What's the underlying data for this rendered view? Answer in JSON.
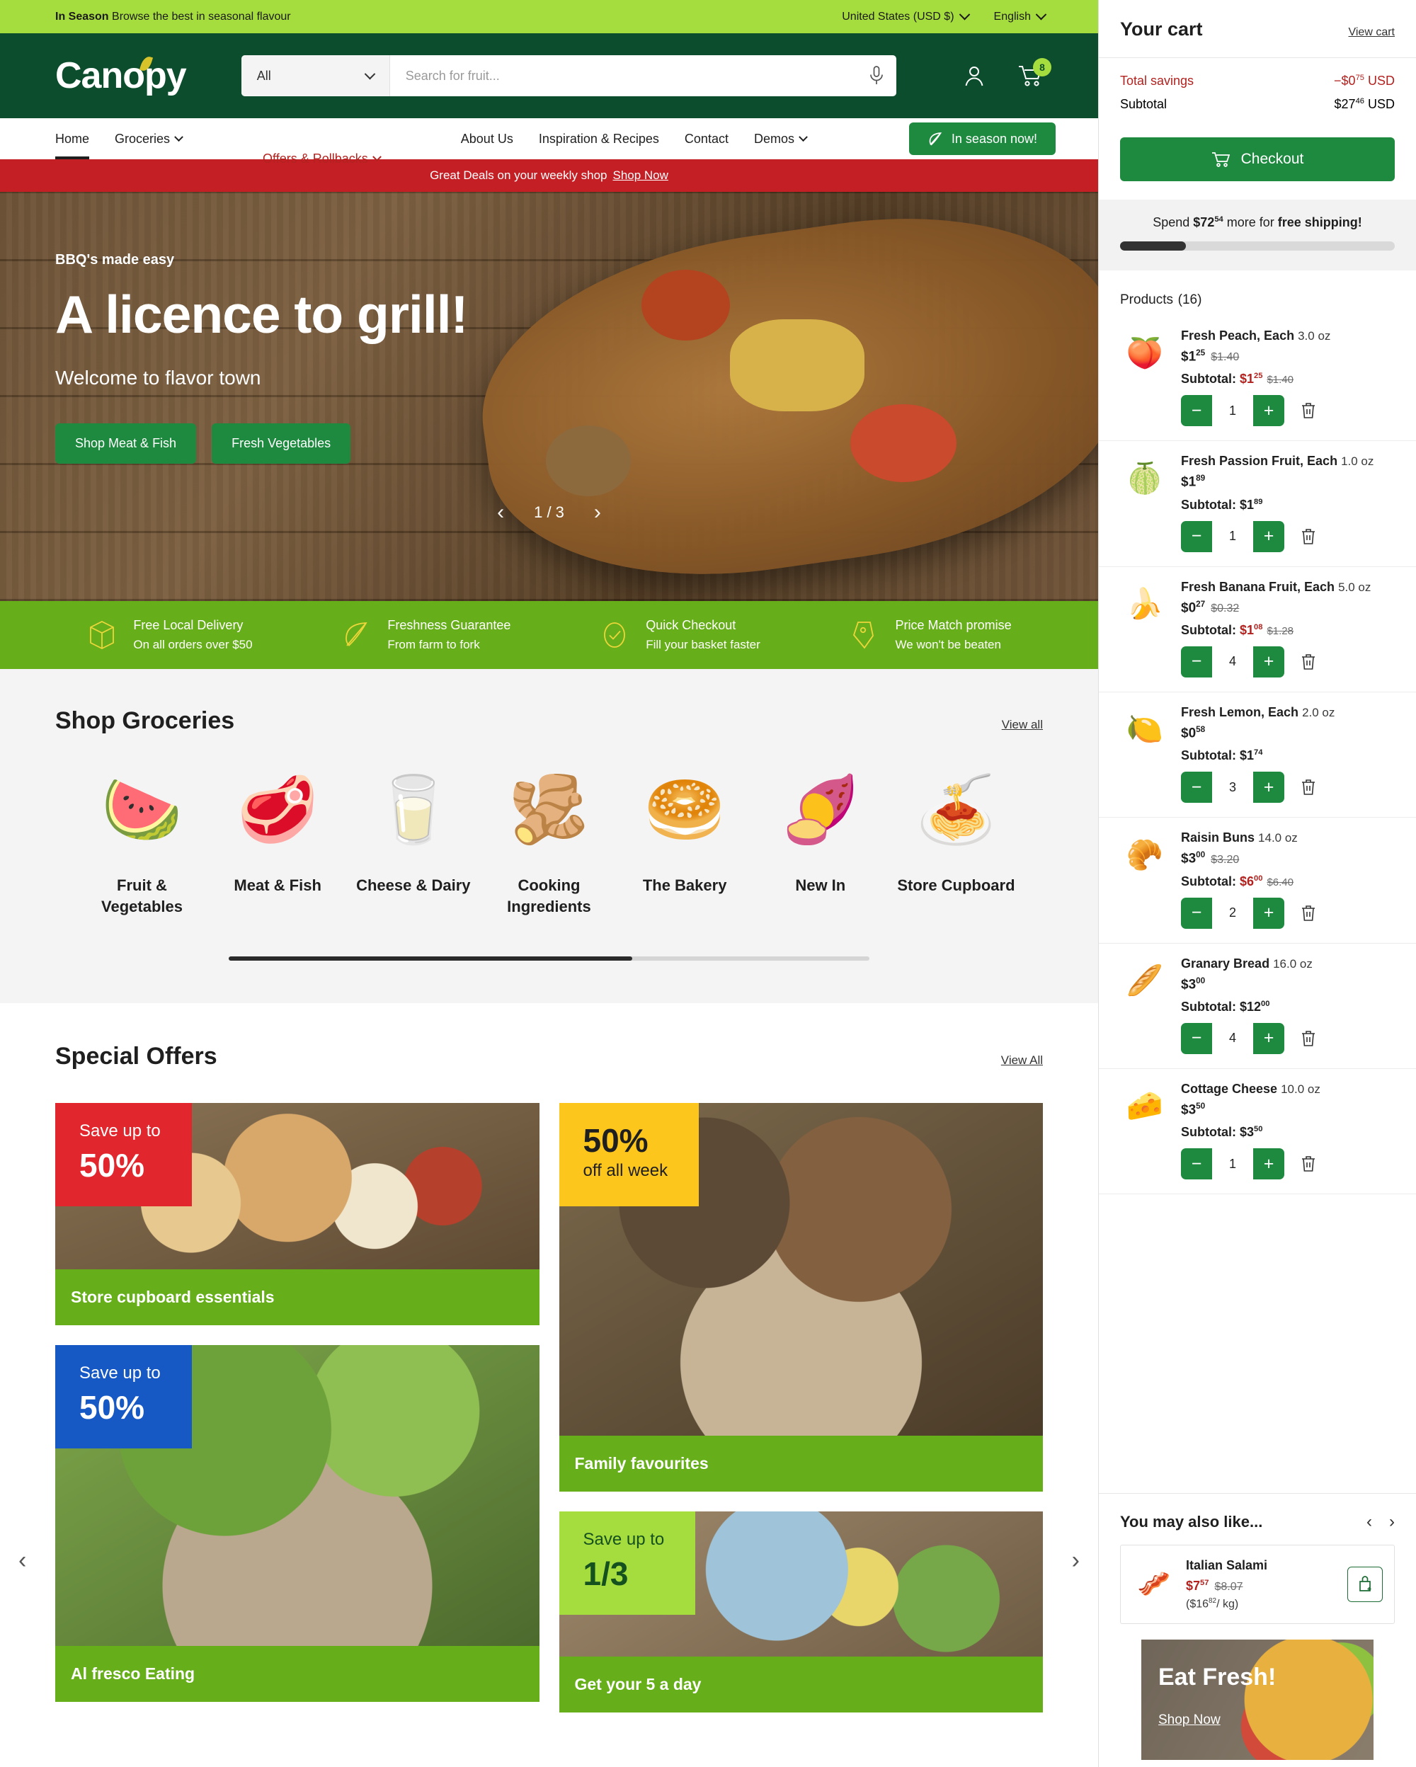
{
  "topbar": {
    "in_season_label": "In Season",
    "in_season_text": " Browse the best in seasonal flavour",
    "country": "United States (USD $)",
    "language": "English"
  },
  "header": {
    "logo": "Canopy",
    "search_category": "All",
    "search_placeholder": "Search for fruit...",
    "cart_badge": "8"
  },
  "nav": {
    "items": [
      {
        "label": "Home"
      },
      {
        "label": "Groceries"
      },
      {
        "label": "Offers & Rollbacks"
      },
      {
        "label": "About Us"
      },
      {
        "label": "Inspiration & Recipes"
      },
      {
        "label": "Contact"
      },
      {
        "label": "Demos"
      }
    ],
    "season_button": "In season now!"
  },
  "promo": {
    "text": "Great Deals on your weekly shop",
    "link": "Shop Now"
  },
  "hero": {
    "eyebrow": "BBQ's made easy",
    "title": "A licence to grill!",
    "subtitle": "Welcome to flavor town",
    "button_1": "Shop Meat & Fish",
    "button_2": "Fresh Vegetables",
    "counter": "1 / 3"
  },
  "features": [
    {
      "icon": "box-icon",
      "title": "Free Local Delivery",
      "sub": "On all orders over $50"
    },
    {
      "icon": "leaf-icon",
      "title": "Freshness Guarantee",
      "sub": "From farm to fork"
    },
    {
      "icon": "check-circle-icon",
      "title": "Quick Checkout",
      "sub": "Fill your basket faster"
    },
    {
      "icon": "tag-icon",
      "title": "Price Match promise",
      "sub": "We won't be beaten"
    }
  ],
  "groceries": {
    "title": "Shop Groceries",
    "view_all": "View all",
    "categories": [
      {
        "label": "Fruit & Vegetables",
        "emoji": "🍉"
      },
      {
        "label": "Meat & Fish",
        "emoji": "🥩"
      },
      {
        "label": "Cheese & Dairy",
        "emoji": "🥛"
      },
      {
        "label": "Cooking Ingredients",
        "emoji": "🫚"
      },
      {
        "label": "The Bakery",
        "emoji": "🥯"
      },
      {
        "label": "New In",
        "emoji": "🍠"
      },
      {
        "label": "Store Cupboard",
        "emoji": "🍝"
      }
    ]
  },
  "special_offers": {
    "title": "Special Offers",
    "view_all": "View All",
    "cards": [
      {
        "flag_small": "Save up to",
        "flag_big": "50%",
        "footer": "Store cupboard essentials",
        "flag_color": "red"
      },
      {
        "flag_small": "Save up to",
        "flag_big": "50%",
        "footer": "Al fresco Eating",
        "flag_color": "blue"
      },
      {
        "flag_small": "off all week",
        "flag_big": "50%",
        "footer": "Family favourites",
        "flag_color": "yellow"
      },
      {
        "flag_small": "Save up to",
        "flag_big": "1/3",
        "footer": "Get your 5 a day",
        "flag_color": "lime"
      }
    ]
  },
  "cart": {
    "title": "Your cart",
    "view_cart": "View cart",
    "savings_label": "Total savings",
    "savings_value": "−$0",
    "savings_cents": "75",
    "savings_currency": " USD",
    "subtotal_label": "Subtotal",
    "subtotal_value": "$27",
    "subtotal_cents": "46",
    "subtotal_currency": " USD",
    "checkout_label": "Checkout",
    "shipping_prefix": "Spend ",
    "shipping_amount": "$72",
    "shipping_cents": "54",
    "shipping_suffix": " more for ",
    "shipping_bold": "free shipping!",
    "products_label": "Products",
    "products_count": "(16)",
    "items": [
      {
        "name": "Fresh Peach, Each",
        "size": "3.0 oz",
        "price": "$1",
        "price_cents": "25",
        "price_was": "$1.40",
        "subtotal_label": "Subtotal: ",
        "subtotal": "$1",
        "subtotal_cents": "25",
        "subtotal_was": "$1.40",
        "qty": "1",
        "emoji": "🍑",
        "sale": true
      },
      {
        "name": "Fresh Passion Fruit, Each",
        "size": "1.0 oz",
        "price": "$1",
        "price_cents": "89",
        "price_was": "",
        "subtotal_label": "Subtotal: ",
        "subtotal": "$1",
        "subtotal_cents": "89",
        "subtotal_was": "",
        "qty": "1",
        "emoji": "🍈",
        "sale": false
      },
      {
        "name": "Fresh Banana Fruit, Each",
        "size": "5.0 oz",
        "price": "$0",
        "price_cents": "27",
        "price_was": "$0.32",
        "subtotal_label": "Subtotal: ",
        "subtotal": "$1",
        "subtotal_cents": "08",
        "subtotal_was": "$1.28",
        "qty": "4",
        "emoji": "🍌",
        "sale": true
      },
      {
        "name": "Fresh Lemon, Each",
        "size": "2.0 oz",
        "price": "$0",
        "price_cents": "58",
        "price_was": "",
        "subtotal_label": "Subtotal: ",
        "subtotal": "$1",
        "subtotal_cents": "74",
        "subtotal_was": "",
        "qty": "3",
        "emoji": "🍋",
        "sale": false
      },
      {
        "name": "Raisin Buns",
        "size": "14.0 oz",
        "price": "$3",
        "price_cents": "00",
        "price_was": "$3.20",
        "subtotal_label": "Subtotal: ",
        "subtotal": "$6",
        "subtotal_cents": "00",
        "subtotal_was": "$6.40",
        "qty": "2",
        "emoji": "🥐",
        "sale": true
      },
      {
        "name": "Granary Bread",
        "size": "16.0 oz",
        "price": "$3",
        "price_cents": "00",
        "price_was": "",
        "subtotal_label": "Subtotal: ",
        "subtotal": "$12",
        "subtotal_cents": "00",
        "subtotal_was": "",
        "qty": "4",
        "emoji": "🥖",
        "sale": false
      },
      {
        "name": "Cottage Cheese",
        "size": "10.0 oz",
        "price": "$3",
        "price_cents": "50",
        "price_was": "",
        "subtotal_label": "Subtotal: ",
        "subtotal": "$3",
        "subtotal_cents": "50",
        "subtotal_was": "",
        "qty": "1",
        "emoji": "🧀",
        "sale": false
      }
    ],
    "also_like": {
      "title": "You may also like...",
      "product_name": "Italian Salami",
      "price": "$7",
      "price_cents": "57",
      "price_was": "$8.07",
      "unit_price": "($16",
      "unit_cents": "82",
      "unit_suffix": "/ kg)",
      "emoji": "🥓"
    },
    "banner": {
      "title": "Eat Fresh!",
      "link": "Shop Now"
    }
  }
}
